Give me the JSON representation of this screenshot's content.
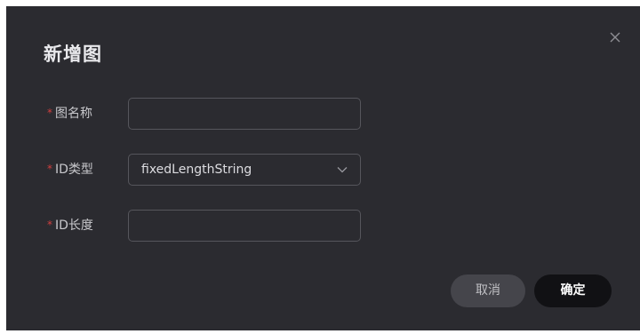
{
  "dialog": {
    "title": "新增图",
    "close_icon": "close-icon",
    "fields": {
      "name": {
        "required_mark": "*",
        "label": "图名称",
        "value": "",
        "placeholder": ""
      },
      "id_type": {
        "required_mark": "*",
        "label": "ID类型",
        "selected": "fixedLengthString",
        "icon": "chevron-down-icon"
      },
      "id_length": {
        "required_mark": "*",
        "label": "ID长度",
        "value": "",
        "placeholder": ""
      }
    },
    "buttons": {
      "cancel": "取消",
      "confirm": "确定"
    }
  },
  "colors": {
    "dialog_bg": "#2b2b30",
    "required_star": "#d23f3f",
    "confirm_bg": "#111114",
    "cancel_bg": "#45454b"
  }
}
